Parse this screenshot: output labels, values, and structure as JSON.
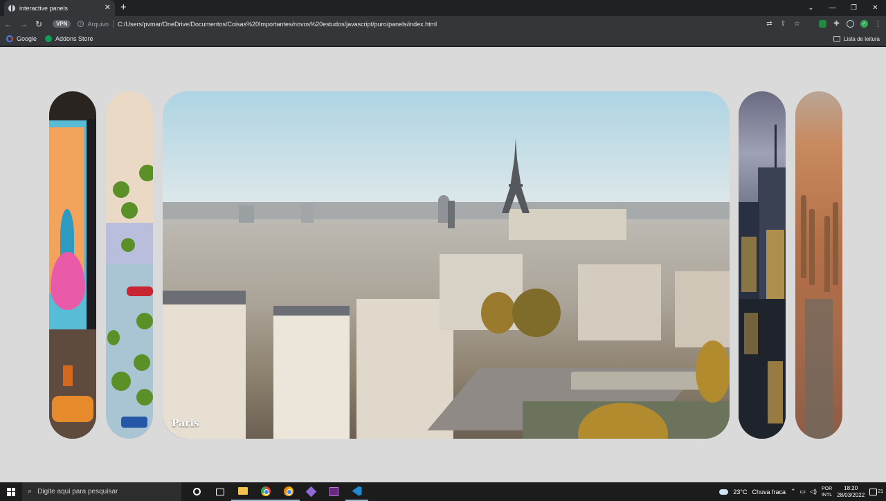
{
  "browser": {
    "tab_title": "interactive panels",
    "new_tab_label": "+",
    "address": {
      "vpn_label": "VPN",
      "scheme_label": "Arquivo",
      "url": "C:/Users/pvmar/OneDrive/Documentos/Coisas%20Importantes/novos%20estudos/javascript/puro/panels/index.html"
    },
    "bookmarks": [
      {
        "label": "Google"
      },
      {
        "label": "Addons Store"
      }
    ],
    "reading_list_label": "Lista de leitura"
  },
  "panels": [
    {
      "label": "",
      "theme": "colorful street billboard"
    },
    {
      "label": "",
      "theme": "aerial beach palms"
    },
    {
      "label": "Paris",
      "active": true,
      "theme": "paris eiffel tower"
    },
    {
      "label": "",
      "theme": "skyscrapers"
    },
    {
      "label": "",
      "theme": "aerial city"
    }
  ],
  "taskbar": {
    "search_placeholder": "Digite aqui para pesquisar",
    "weather_temp": "23°C",
    "weather_text": "Chuva fraca",
    "lang_top": "POR",
    "lang_bottom": "INTL",
    "time": "18:20",
    "date": "28/03/2022",
    "notification_count": "21"
  },
  "colors": {
    "page_bg": "#dadada",
    "chrome_dark": "#202124",
    "chrome_toolbar": "#35363a"
  }
}
